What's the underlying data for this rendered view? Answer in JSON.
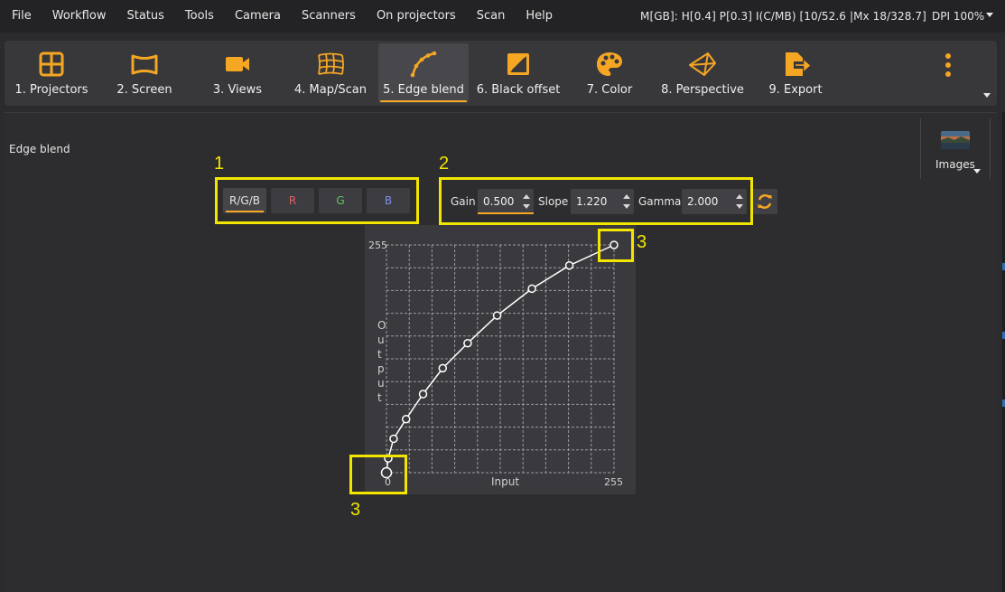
{
  "menu": {
    "items": [
      "File",
      "Workflow",
      "Status",
      "Tools",
      "Camera",
      "Scanners",
      "On projectors",
      "Scan",
      "Help"
    ],
    "status_text": "M[GB]: H[0.4] P[0.3] I(C/MB) [10/52.6 |Mx 18/328.7]",
    "dpi_text": "DPI 100%"
  },
  "toolbar": {
    "tools": [
      {
        "label": "1. Projectors",
        "icon": "grid-icon"
      },
      {
        "label": "2. Screen",
        "icon": "curved-screen-icon"
      },
      {
        "label": "3. Views",
        "icon": "video-camera-icon"
      },
      {
        "label": "4. Map/Scan",
        "icon": "warped-grid-icon"
      },
      {
        "label": "5. Edge blend",
        "icon": "blend-curve-icon",
        "active": true
      },
      {
        "label": "6. Black offset",
        "icon": "black-offset-icon"
      },
      {
        "label": "7. Color",
        "icon": "palette-icon"
      },
      {
        "label": "8. Perspective",
        "icon": "perspective-icon"
      },
      {
        "label": "9. Export",
        "icon": "export-icon"
      }
    ],
    "accent_color": "#f5a623"
  },
  "page": {
    "title": "Edge blend"
  },
  "images_panel": {
    "label": "Images"
  },
  "channels": {
    "buttons": [
      {
        "label": "R/G/B",
        "color": "#e6e6e6",
        "active": true
      },
      {
        "label": "R",
        "color": "#e06060"
      },
      {
        "label": "G",
        "color": "#5cc85c"
      },
      {
        "label": "B",
        "color": "#7a8fe8"
      }
    ]
  },
  "params": {
    "gain_label": "Gain",
    "gain_value": "0.500",
    "slope_label": "Slope",
    "slope_value": "1.220",
    "gamma_label": "Gamma",
    "gamma_value": "2.000"
  },
  "annotations": {
    "box1_number": "1",
    "box2_number": "2",
    "box3_top_number": "3",
    "box3_bottom_number": "3",
    "color": "#f2e600"
  },
  "chart_data": {
    "type": "line",
    "xlabel": "Input",
    "ylabel": "Output",
    "x_tick_labels": [
      "0",
      "255"
    ],
    "y_tick_labels": [
      "255"
    ],
    "xlim": [
      0,
      255
    ],
    "ylim": [
      0,
      255
    ],
    "grid": true,
    "series": [
      {
        "x": [
          0,
          2,
          8,
          22,
          41,
          63,
          91,
          124,
          163,
          205,
          255
        ],
        "y": [
          0,
          16,
          38,
          60,
          88,
          117,
          145,
          176,
          206,
          232,
          255
        ]
      }
    ],
    "line_color": "#ffffff"
  }
}
